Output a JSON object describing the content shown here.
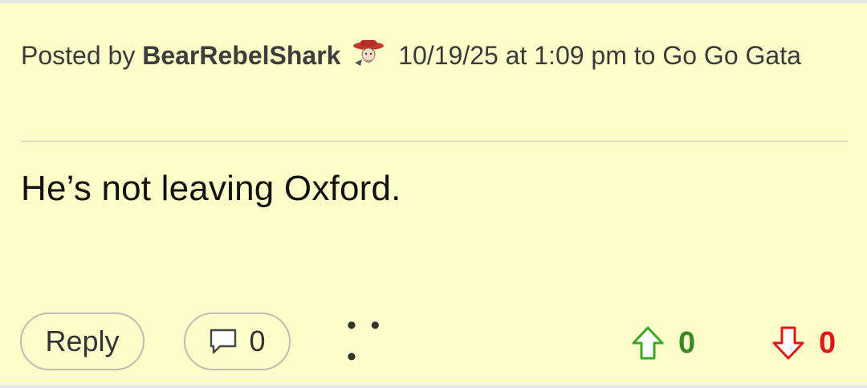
{
  "post": {
    "posted_by_prefix": "Posted by",
    "author": "BearRebelShark",
    "timestamp": "10/19/25 at 1:09 pm",
    "to_prefix": "to",
    "recipient": "Go Go Gata",
    "avatar_icon": "colonel-reb-avatar-icon",
    "body": "He’s not leaving Oxford."
  },
  "actions": {
    "reply_label": "Reply",
    "comment_count": "0",
    "more_label": "• • •",
    "upvote_count": "0",
    "downvote_count": "0",
    "upvote_color": "#3a8a24",
    "downvote_color": "#e01818"
  },
  "colors": {
    "post_background": "#fdfdc9",
    "border": "#e6e6e6"
  }
}
